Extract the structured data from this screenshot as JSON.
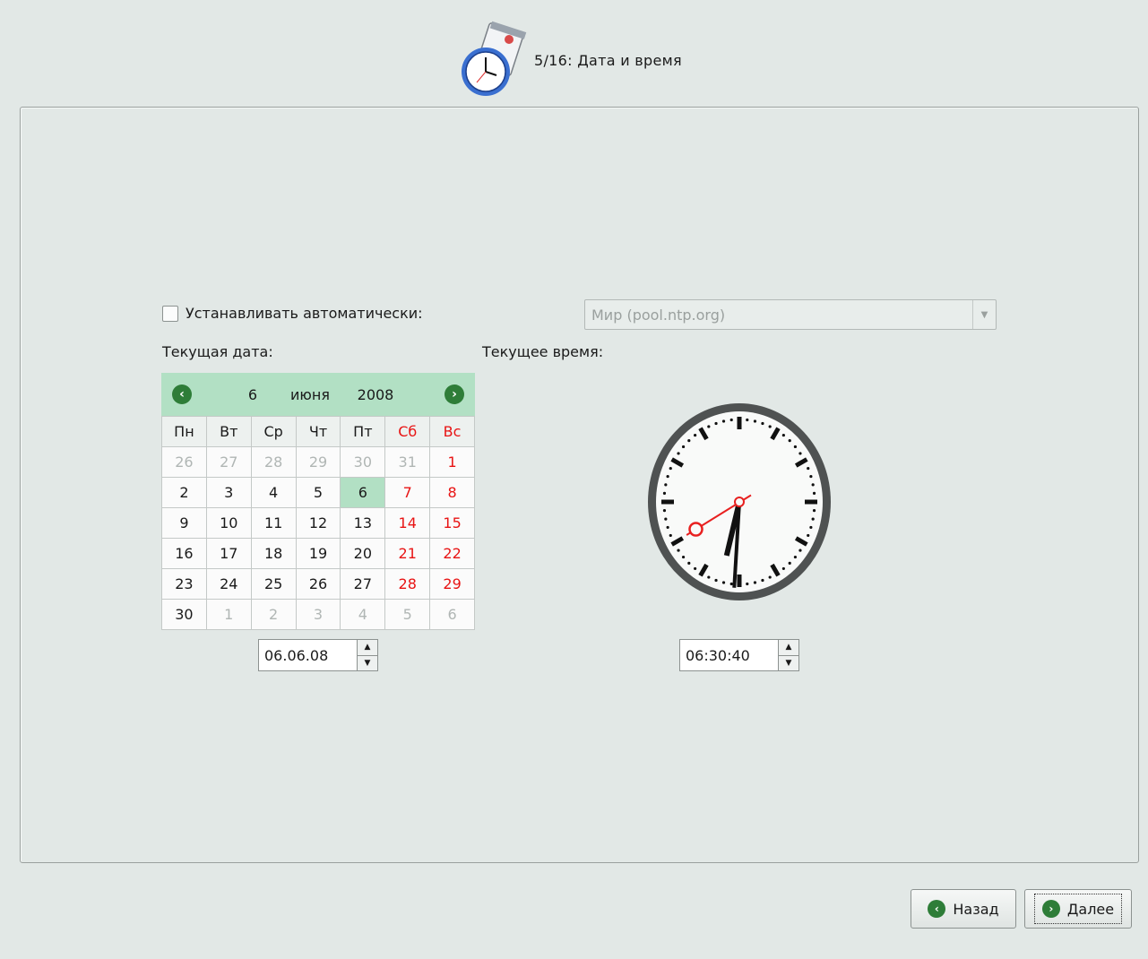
{
  "header": {
    "title": "5/16: Дата и время",
    "icon": "clock-calendar-icon"
  },
  "auto": {
    "label": "Устанавливать автоматически:",
    "checked": false
  },
  "server": {
    "value": "Мир (pool.ntp.org)"
  },
  "date_section": {
    "label": "Текущая дата:"
  },
  "time_section": {
    "label": "Текущее время:"
  },
  "calendar": {
    "day": "6",
    "month": "июня",
    "year": "2008",
    "weekdays": [
      "Пн",
      "Вт",
      "Ср",
      "Чт",
      "Пт",
      "Сб",
      "Вс"
    ],
    "weeks": [
      [
        "26",
        "27",
        "28",
        "29",
        "30",
        "31",
        "1"
      ],
      [
        "2",
        "3",
        "4",
        "5",
        "6",
        "7",
        "8"
      ],
      [
        "9",
        "10",
        "11",
        "12",
        "13",
        "14",
        "15"
      ],
      [
        "16",
        "17",
        "18",
        "19",
        "20",
        "21",
        "22"
      ],
      [
        "23",
        "24",
        "25",
        "26",
        "27",
        "28",
        "29"
      ],
      [
        "30",
        "1",
        "2",
        "3",
        "4",
        "5",
        "6"
      ]
    ],
    "selected": "6"
  },
  "date_value": "06.06.08",
  "time_value": "06:30:40",
  "clock": {
    "hours": 6,
    "minutes": 30,
    "seconds": 40
  },
  "buttons": {
    "back": "Назад",
    "next": "Далее"
  },
  "colors": {
    "accent": "#b2e0c4",
    "weekend": "#e81313",
    "icon_green": "#2e7d38"
  }
}
